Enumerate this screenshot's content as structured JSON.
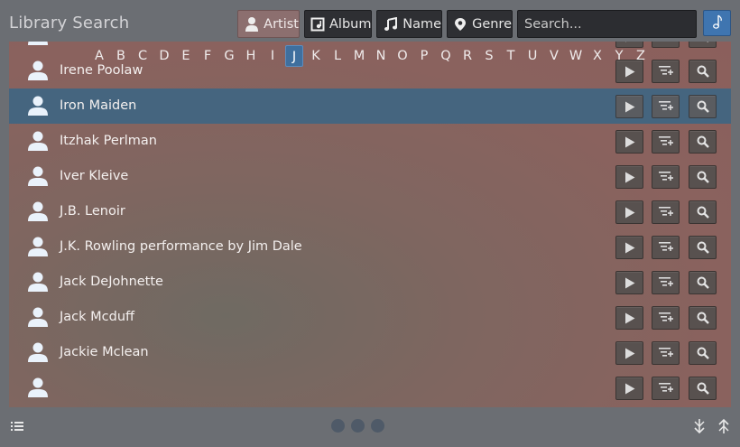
{
  "header": {
    "title": "Library Search",
    "filters": [
      {
        "label": "Artist",
        "icon": "person-icon",
        "active": true
      },
      {
        "label": "Album",
        "icon": "album-icon",
        "active": false
      },
      {
        "label": "Name",
        "icon": "music-note-icon",
        "active": false
      },
      {
        "label": "Genre",
        "icon": "genre-icon",
        "active": false
      }
    ],
    "search_placeholder": "Search...",
    "mode_icon": "music-note-icon"
  },
  "alphabet": {
    "letters": [
      "A",
      "B",
      "C",
      "D",
      "E",
      "F",
      "G",
      "H",
      "I",
      "J",
      "K",
      "L",
      "M",
      "N",
      "O",
      "P",
      "Q",
      "R",
      "S",
      "T",
      "U",
      "V",
      "W",
      "X",
      "Y",
      "Z"
    ],
    "selected": "J"
  },
  "artists": [
    {
      "name": "",
      "partial": true
    },
    {
      "name": "Irene Poolaw"
    },
    {
      "name": "Iron Maiden",
      "selected": true
    },
    {
      "name": "Itzhak Perlman"
    },
    {
      "name": "Iver Kleive"
    },
    {
      "name": "J.B. Lenoir"
    },
    {
      "name": "J.K. Rowling performance by Jim Dale"
    },
    {
      "name": "Jack DeJohnette"
    },
    {
      "name": "Jack Mcduff"
    },
    {
      "name": "Jackie Mclean"
    },
    {
      "name": "",
      "partial": true
    }
  ],
  "row_actions": [
    "play-icon",
    "enqueue-icon",
    "search-icon"
  ],
  "footer": {
    "page_count": 3,
    "current_page": 3
  },
  "colors": {
    "accent": "#3f75b0",
    "selected_row": "#45657f",
    "panel": "#8b5f5c",
    "chrome": "#6b6e73"
  }
}
